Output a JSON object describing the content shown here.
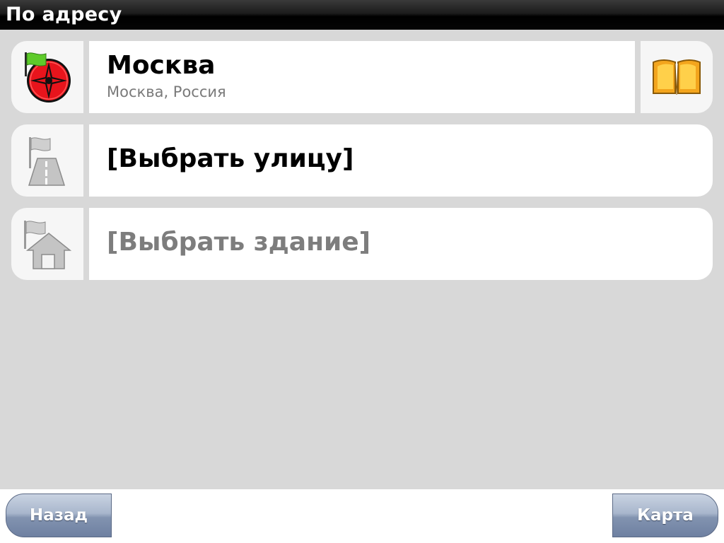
{
  "header": {
    "title": "По адресу"
  },
  "rows": {
    "city": {
      "title": "Москва",
      "subtitle": "Москва, Россия"
    },
    "street": {
      "title": "[Выбрать улицу]"
    },
    "building": {
      "title": "[Выбрать здание]"
    }
  },
  "footer": {
    "back_label": "Назад",
    "map_label": "Карта"
  },
  "icons": {
    "city": "flag-compass-icon",
    "street": "flag-road-icon",
    "building": "flag-house-icon",
    "book": "book-icon"
  },
  "colors": {
    "background": "#d8d8d8",
    "compass_red": "#e8141c",
    "flag_green": "#5ecb2a",
    "book_orange": "#f3a51d",
    "button_blue": "#8293b0"
  }
}
